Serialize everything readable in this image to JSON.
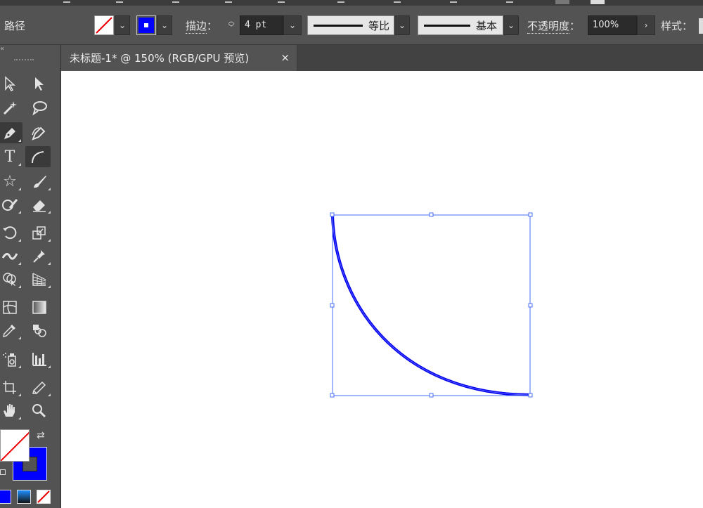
{
  "control_bar": {
    "object_type": "路径",
    "stroke_label": "描边",
    "stroke_weight": "4 pt",
    "variable_width_profile": "等比",
    "brush_definition": "基本",
    "opacity_label": "不透明度",
    "opacity_value": "100%",
    "style_label": "样式",
    "stroke_color": "#0000ff",
    "colon": "："
  },
  "document_tab": {
    "title": "未标题-1* @ 150% (RGB/GPU 预览)",
    "close": "×"
  },
  "toolbar": {
    "tools": [
      "selection-tool",
      "direct-selection-tool",
      "magic-wand-tool",
      "lasso-tool",
      "pen-tool",
      "curvature-tool",
      "type-tool",
      "arc-tool",
      "star-tool",
      "paintbrush-tool",
      "shaper-tool",
      "eraser-tool",
      "rotate-tool",
      "scale-tool",
      "width-tool",
      "puppet-warp-tool",
      "shape-builder-tool",
      "perspective-grid-tool",
      "mesh-tool",
      "gradient-tool",
      "eyedropper-tool",
      "blend-tool",
      "symbol-sprayer-tool",
      "column-graph-tool",
      "artboard-tool",
      "slice-tool",
      "hand-tool",
      "zoom-tool"
    ]
  },
  "colors": {
    "fill": "none",
    "stroke": "#0000ff",
    "accent": "#4a6cf7"
  }
}
